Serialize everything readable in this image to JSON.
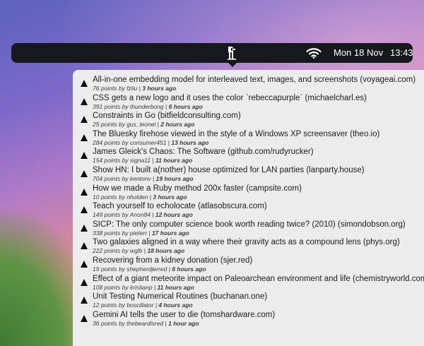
{
  "menubar": {
    "date": "Mon 18 Nov",
    "time": "13:43",
    "icons": [
      "app-icon",
      "wifi-icon"
    ]
  },
  "items": [
    {
      "title": "All-in-one embedding model for interleaved text, images, and screenshots (voyageai.com)",
      "meta_prefix": "76 points by fzliu | ",
      "age": "3 hours ago"
    },
    {
      "title": "CSS gets a new logo and it uses the color `rebeccapurple` (michaelcharl.es)",
      "meta_prefix": "391 points by thunderbong | ",
      "age": "6 hours ago"
    },
    {
      "title": "Constraints in Go (bitfieldconsulting.com)",
      "meta_prefix": "25 points by gus_leonel | ",
      "age": "2 hours ago"
    },
    {
      "title": "The Bluesky firehose viewed in the style of a Windows XP screensaver (theo.io)",
      "meta_prefix": "284 points by consumer451 | ",
      "age": "13 hours ago"
    },
    {
      "title": "James Gleick's Chaos: The Software (github.com/rudyrucker)",
      "meta_prefix": "154 points by signa11 | ",
      "age": "11 hours ago"
    },
    {
      "title": "Show HN: I built a(nother) house optimized for LAN parties (lanparty.house)",
      "meta_prefix": "704 points by kentonv | ",
      "age": "19 hours ago"
    },
    {
      "title": "How we made a Ruby method 200x faster (campsite.com)",
      "meta_prefix": "10 points by nholden | ",
      "age": "3 hours ago"
    },
    {
      "title": "Teach yourself to echolocate (atlasobscura.com)",
      "meta_prefix": "149 points by Anon84 | ",
      "age": "12 hours ago"
    },
    {
      "title": "SICP: The only computer science book worth reading twice? (2010) (simondobson.org)",
      "meta_prefix": "338 points by pieterr | ",
      "age": "17 hours ago"
    },
    {
      "title": "Two galaxies aligned in a way where their gravity acts as a compound lens (phys.org)",
      "meta_prefix": "222 points by wglb | ",
      "age": "18 hours ago"
    },
    {
      "title": "Recovering from a kidney donation (sjer.red)",
      "meta_prefix": "19 points by shepherdjerred | ",
      "age": "6 hours ago"
    },
    {
      "title": "Effect of a giant meteorite impact on Paleoarchean environment and life (chemistryworld.com)",
      "meta_prefix": "108 points by kristianp | ",
      "age": "11 hours ago"
    },
    {
      "title": "Unit Testing Numerical Routines (buchanan.one)",
      "meta_prefix": "12 points by boscillator | ",
      "age": "4 hours ago"
    },
    {
      "title": "Gemini AI tells the user to die (tomshardware.com)",
      "meta_prefix": "36 points by thebeardisred | ",
      "age": "1 hour ago"
    }
  ]
}
